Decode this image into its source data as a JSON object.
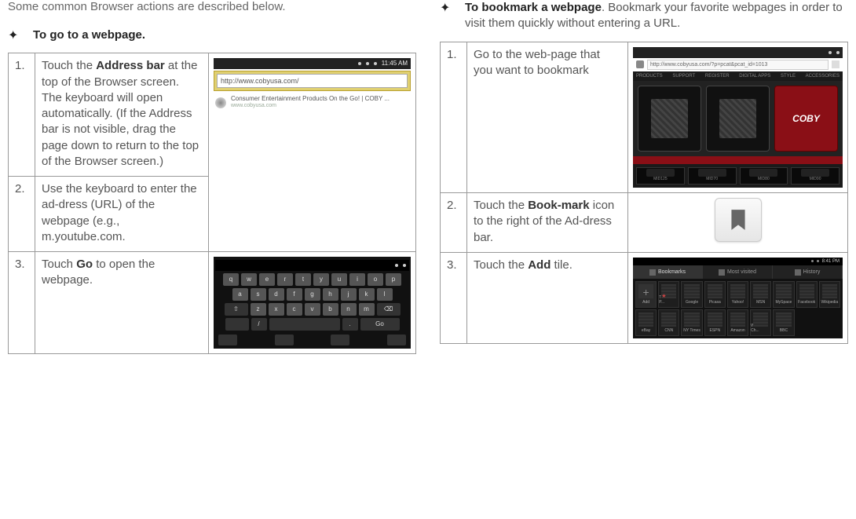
{
  "intro": "Some common Browser actions are described below.",
  "left": {
    "heading_bold": "To go to a webpage.",
    "steps": [
      {
        "num": "1.",
        "pre": "Touch the ",
        "bold": "Address bar",
        "post": " at the top of the Browser screen. The keyboard will open automatically. (If the Address bar is not visible, drag the page down to return to the top of the Browser screen.)"
      },
      {
        "num": "2.",
        "pre": "Use the keyboard to enter the ad-dress (URL) of the webpage (e.g., m.youtube.com.",
        "bold": "",
        "post": ""
      },
      {
        "num": "3.",
        "pre": "Touch ",
        "bold": "Go",
        "post": " to open the webpage."
      }
    ],
    "address_url": "http://www.cobyusa.com/",
    "result_title": "Consumer Entertainment Products On the Go! | COBY ...",
    "result_sub": "www.cobyusa.com",
    "clock": "11:45 AM",
    "keys_row1": [
      "q",
      "w",
      "e",
      "r",
      "t",
      "y",
      "u",
      "i",
      "o",
      "p"
    ],
    "keys_row2": [
      "a",
      "s",
      "d",
      "f",
      "g",
      "h",
      "j",
      "k",
      "l"
    ],
    "keys_row3": [
      "z",
      "x",
      "c",
      "v",
      "b",
      "n",
      "m"
    ]
  },
  "right": {
    "heading_bold": "To bookmark a webpage",
    "heading_rest": ". Bookmark your favorite webpages in order to visit them quickly without entering a URL.",
    "steps": [
      {
        "num": "1.",
        "pre": "Go to the web-page that you want to bookmark",
        "bold": "",
        "post": ""
      },
      {
        "num": "2.",
        "pre": "Touch the ",
        "bold": "Book-mark",
        "post": " icon to the right of the Ad-dress bar."
      },
      {
        "num": "3.",
        "pre": "Touch the ",
        "bold": "Add",
        "post": " tile."
      }
    ],
    "coby_url": "http://www.cobyusa.com/?p=pcat&pcat_id=1013",
    "coby_logo": "COBY",
    "thumb_labels": [
      "MID125",
      "MID70",
      "MID80",
      "MID90"
    ],
    "tabs": [
      "Bookmarks",
      "Most visited",
      "History"
    ],
    "tiles_row1": [
      "Add",
      "Tablets & P...",
      "Google",
      "Picasa",
      "Yahoo!",
      "MSN",
      "MySpace",
      "Facebook",
      "Wikipedia"
    ],
    "tiles_row2": [
      "eBay",
      "CNN",
      "NY Times",
      "ESPN",
      "Amazon",
      "Weather Ch...",
      "BBC"
    ],
    "clock": "8:41 PM"
  }
}
